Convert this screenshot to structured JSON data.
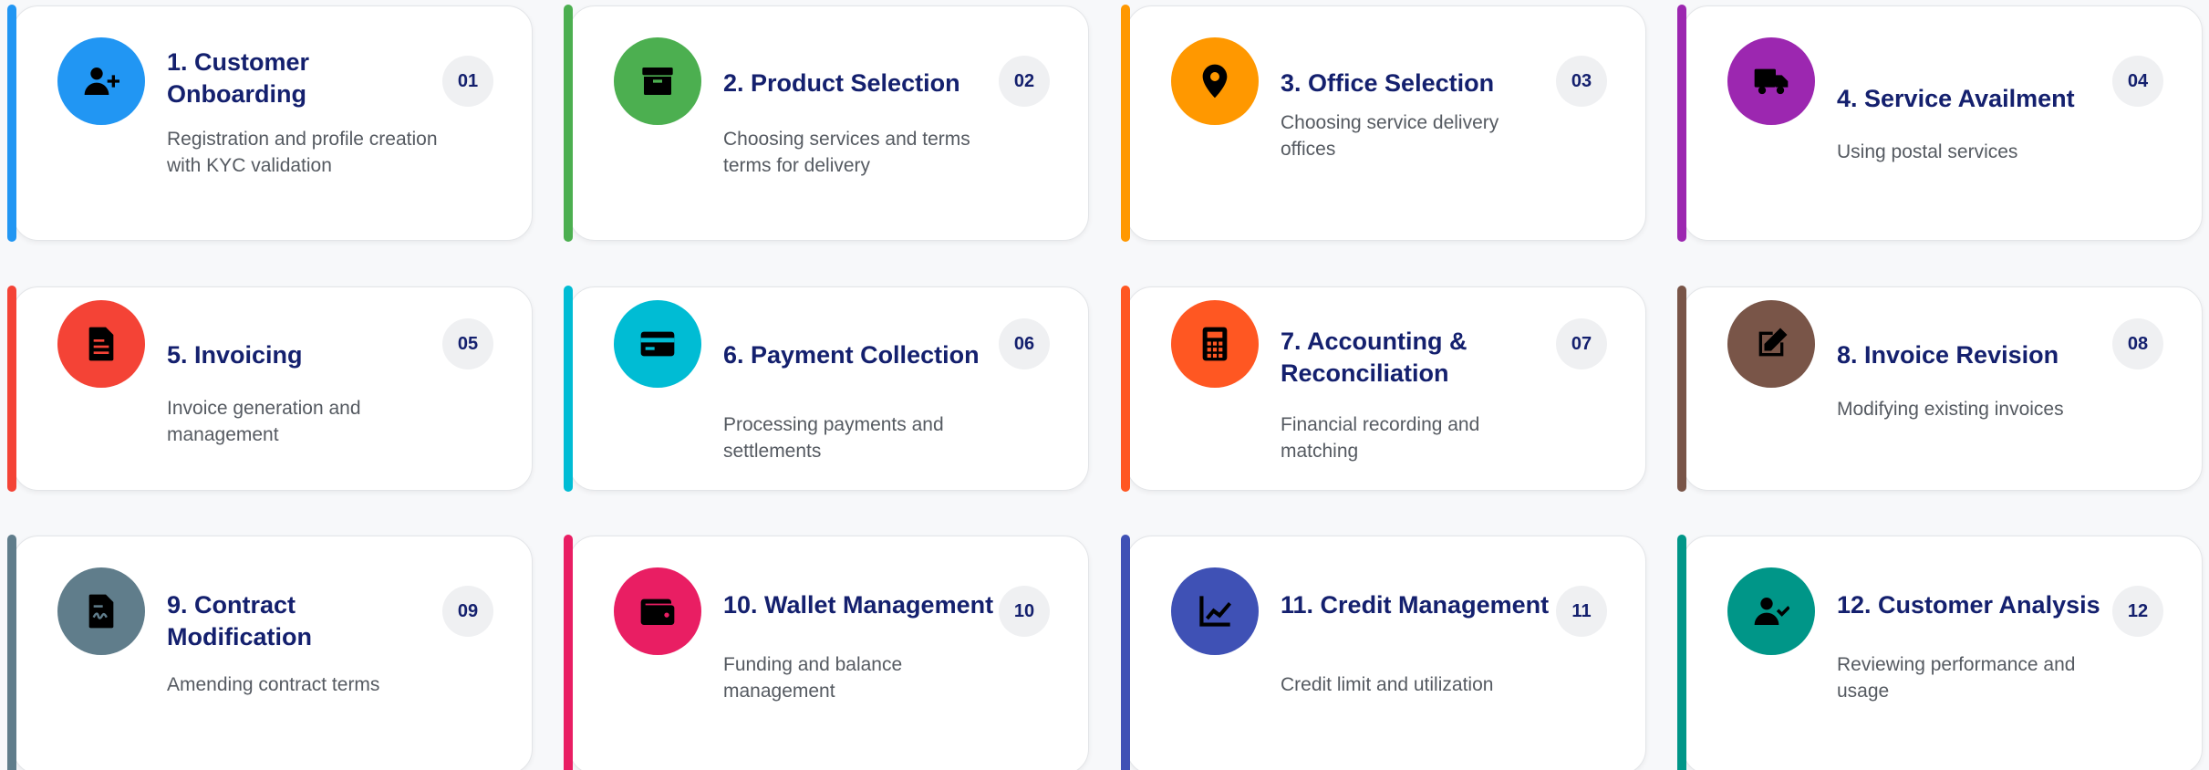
{
  "cards": [
    {
      "num": "01",
      "title": "1. Customer Onboarding",
      "desc": "Registration and profile creation with KYC validation",
      "color": "#2196f3",
      "icon": "user-plus-icon"
    },
    {
      "num": "02",
      "title": "2. Product Selection",
      "desc": "Choosing services and terms terms for delivery",
      "color": "#4caf50",
      "icon": "box-icon"
    },
    {
      "num": "03",
      "title": "3. Office Selection",
      "desc": "Choosing service delivery offices",
      "color": "#ff9800",
      "icon": "location-pin-icon"
    },
    {
      "num": "04",
      "title": "4. Service Availment",
      "desc": "Using postal services",
      "color": "#9c27b0",
      "icon": "truck-icon"
    },
    {
      "num": "05",
      "title": "5. Invoicing",
      "desc": "Invoice generation and management",
      "color": "#f44336",
      "icon": "invoice-icon"
    },
    {
      "num": "06",
      "title": "6. Payment Collection",
      "desc": "Processing payments and settlements",
      "color": "#00bcd4",
      "icon": "credit-card-icon"
    },
    {
      "num": "07",
      "title": "7. Accounting & Reconciliation",
      "desc": "Financial recording and matching",
      "color": "#ff5722",
      "icon": "calculator-icon"
    },
    {
      "num": "08",
      "title": "8. Invoice Revision",
      "desc": "Modifying existing invoices",
      "color": "#795548",
      "icon": "edit-icon"
    },
    {
      "num": "09",
      "title": "9. Contract Modification",
      "desc": "Amending contract terms",
      "color": "#607d8b",
      "icon": "contract-icon"
    },
    {
      "num": "10",
      "title": "10. Wallet Management",
      "desc": "Funding and balance management",
      "color": "#e91e63",
      "icon": "wallet-icon"
    },
    {
      "num": "11",
      "title": "11. Credit Management",
      "desc": "Credit limit and utilization",
      "color": "#3f51b5",
      "icon": "chart-line-icon"
    },
    {
      "num": "12",
      "title": "12. Customer Analysis",
      "desc": "Reviewing performance and usage",
      "color": "#009688",
      "icon": "user-check-icon"
    }
  ]
}
